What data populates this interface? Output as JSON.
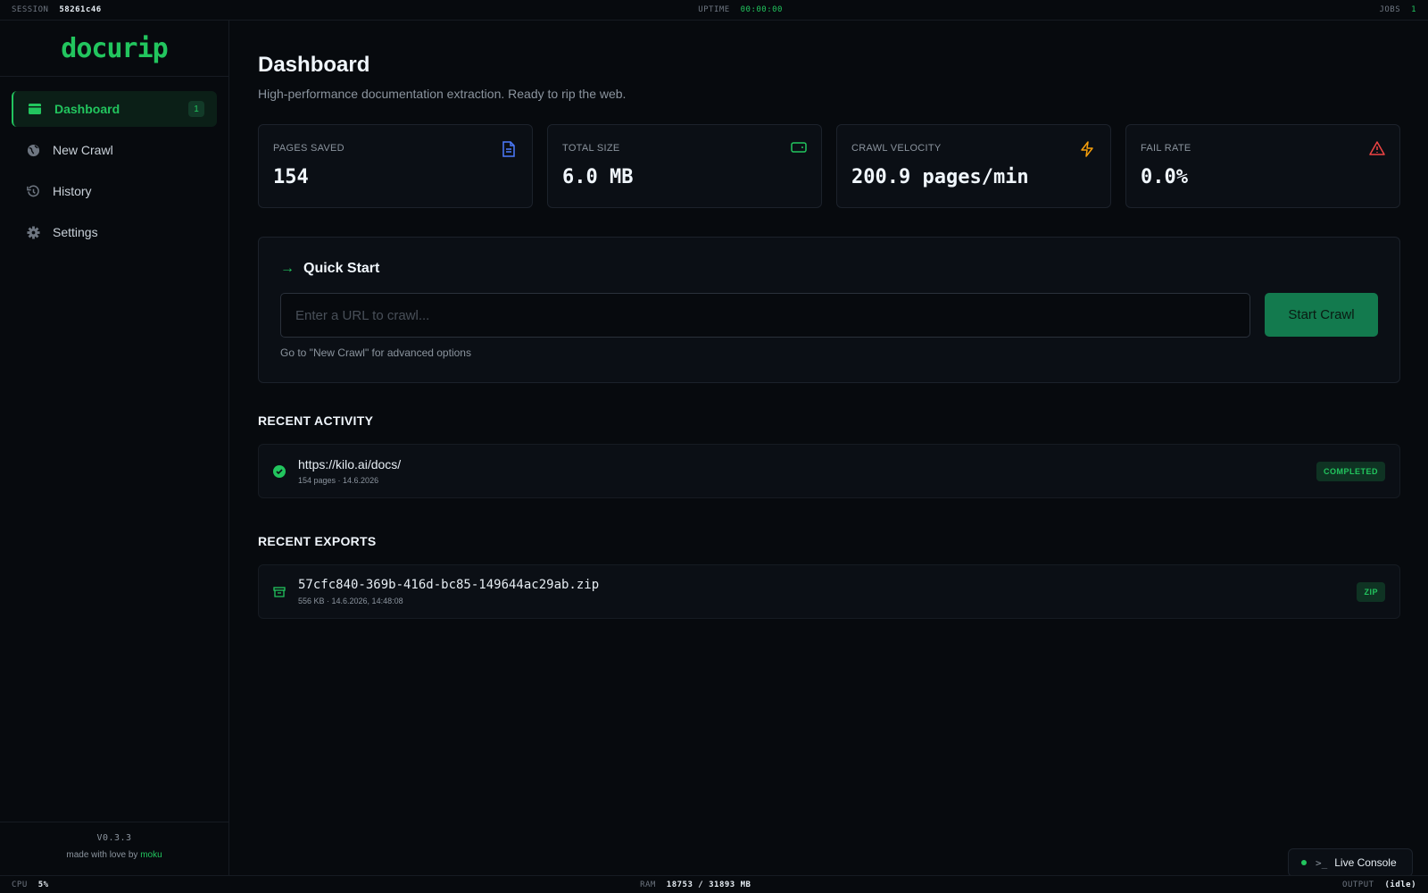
{
  "status_top": {
    "session_label": "SESSION",
    "session_value": "58261c46",
    "uptime_label": "UPTIME",
    "uptime_value": "00:00:00",
    "jobs_label": "JOBS",
    "jobs_value": "1"
  },
  "brand": {
    "logo": "docurip"
  },
  "sidebar": {
    "items": [
      {
        "label": "Dashboard",
        "icon": "dashboard-icon",
        "badge": "1",
        "active": true
      },
      {
        "label": "New Crawl",
        "icon": "globe-icon"
      },
      {
        "label": "History",
        "icon": "history-icon"
      },
      {
        "label": "Settings",
        "icon": "gear-icon"
      }
    ],
    "version": "V0.3.3",
    "made_with": "made with love by",
    "author": "moku"
  },
  "header": {
    "title": "Dashboard",
    "subtitle": "High-performance documentation extraction. Ready to rip the web."
  },
  "stats": [
    {
      "label": "PAGES SAVED",
      "value": "154",
      "icon": "document-icon",
      "color": "#4d7cfe"
    },
    {
      "label": "TOTAL SIZE",
      "value": "6.0 MB",
      "icon": "drive-icon",
      "color": "#22c55e"
    },
    {
      "label": "CRAWL VELOCITY",
      "value": "200.9 pages/min",
      "icon": "lightning-icon",
      "color": "#f59e0b"
    },
    {
      "label": "FAIL RATE",
      "value": "0.0%",
      "icon": "warning-icon",
      "color": "#ef4444"
    }
  ],
  "quick_start": {
    "title": "Quick Start",
    "placeholder": "Enter a URL to crawl...",
    "button": "Start Crawl",
    "hint": "Go to \"New Crawl\" for advanced options"
  },
  "recent_activity": {
    "title": "RECENT ACTIVITY",
    "items": [
      {
        "url": "https://kilo.ai/docs/",
        "meta": "154 pages · 14.6.2026",
        "status": "COMPLETED"
      }
    ]
  },
  "recent_exports": {
    "title": "RECENT EXPORTS",
    "items": [
      {
        "name": "57cfc840-369b-416d-bc85-149644ac29ab.zip",
        "meta": "556 KB · 14.6.2026, 14:48:08",
        "format": "ZIP"
      }
    ]
  },
  "live_console": {
    "label": "Live Console"
  },
  "status_bottom": {
    "cpu_label": "CPU",
    "cpu_value": "5%",
    "ram_label": "RAM",
    "ram_value": "18753 / 31893 MB",
    "output_label": "OUTPUT",
    "output_value": "(idle)"
  },
  "colors": {
    "accent": "#22c55e",
    "background": "#070a0e",
    "card": "#0b0f15"
  }
}
